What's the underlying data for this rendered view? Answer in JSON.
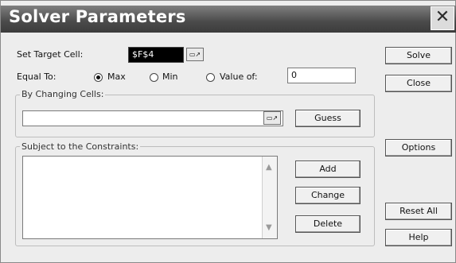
{
  "window": {
    "title": "Solver Parameters",
    "close_symbol": "✕"
  },
  "target": {
    "label": "Set Target Cell:",
    "value": "$F$4"
  },
  "equal_to": {
    "label": "Equal To:",
    "options": [
      "Max",
      "Min",
      "Value of:"
    ],
    "selected": "Max",
    "value_of": "0"
  },
  "changing": {
    "label": "By Changing Cells:",
    "value": ""
  },
  "constraints": {
    "label": "Subject to the Constraints:",
    "items": []
  },
  "buttons": {
    "solve": "Solve",
    "close": "Close",
    "guess": "Guess",
    "options": "Options",
    "add": "Add",
    "change": "Change",
    "delete": "Delete",
    "reset_all": "Reset All",
    "help": "Help"
  },
  "icons": {
    "refedit": "range-select-icon",
    "scroll_up": "chevron-up-icon",
    "scroll_down": "chevron-down-icon"
  }
}
